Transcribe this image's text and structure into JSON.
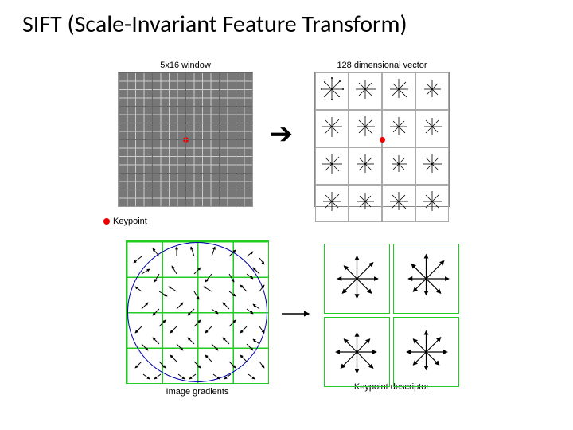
{
  "title": "SIFT (Scale-Invariant Feature Transform)",
  "top_left_caption": "5x16 window",
  "top_right_caption": "128 dimensional vector",
  "legend_label": "Keypoint",
  "bottom_left_caption": "Image gradients",
  "bottom_right_caption": "Keypoint descriptor"
}
